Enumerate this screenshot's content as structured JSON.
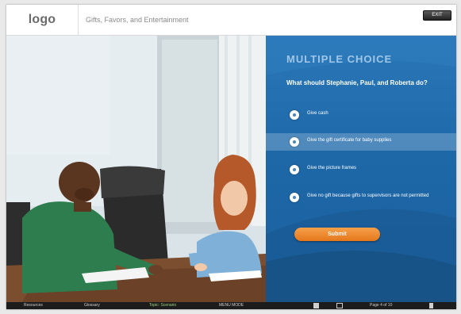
{
  "header": {
    "logo": "logo",
    "course_title": "Gifts, Favors, and Entertainment",
    "top_button": "EXIT"
  },
  "panel": {
    "title": "MULTIPLE CHOICE",
    "question": "What should Stephanie, Paul, and Roberta do?",
    "options": [
      {
        "label": "Give cash",
        "selected": false
      },
      {
        "label": "Give the gift certificate for baby supplies",
        "selected": true
      },
      {
        "label": "Give the picture frames",
        "selected": false
      },
      {
        "label": "Give no gift because gifts to supervisors are not permitted",
        "selected": false
      }
    ],
    "submit_label": "Submit"
  },
  "bottom_bar": {
    "resources": "Resources",
    "glossary": "Glossary",
    "topic": "Topic: Scenario",
    "menu": "MENU MODE",
    "page": "Page 4 of 10"
  },
  "colors": {
    "panel_blue": "#1e68a8",
    "selected_highlight": "#5b95c6",
    "submit_orange": "#e88a2e"
  }
}
